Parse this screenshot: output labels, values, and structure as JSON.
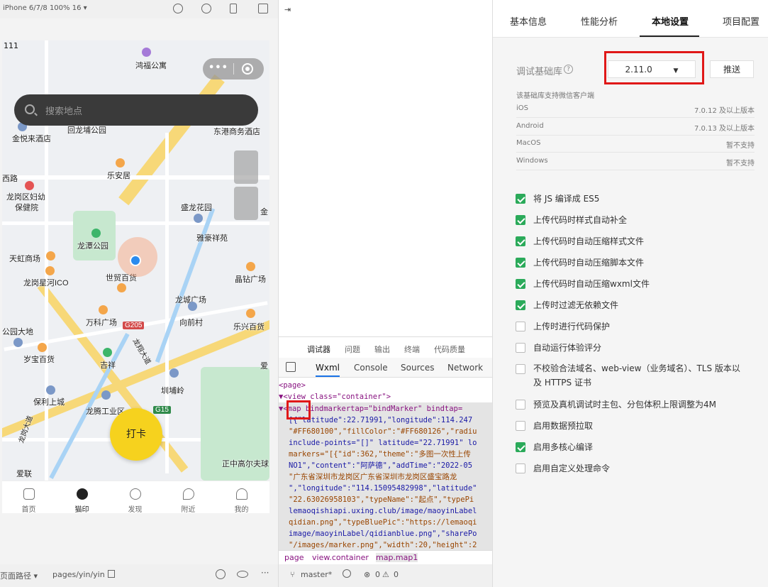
{
  "simulator": {
    "device_label": "iPhone 6/7/8 100% 16 ▾",
    "status_text": "111",
    "search_placeholder": "搜索地点",
    "daka_label": "打卡",
    "tabs": [
      {
        "label": "首页",
        "icon": "home-icon",
        "active": false
      },
      {
        "label": "猫印",
        "icon": "paw-icon",
        "active": true
      },
      {
        "label": "发现",
        "icon": "compass-icon",
        "active": false
      },
      {
        "label": "附近",
        "icon": "location-icon",
        "active": false
      },
      {
        "label": "我的",
        "icon": "user-icon",
        "active": false
      }
    ],
    "map_labels": {
      "l1": "鸿福公寓",
      "l2": "回龙埔公园",
      "l3": "金悦来酒店",
      "l4": "东港商务酒店",
      "l5": "乐安居",
      "l6": "西路",
      "l7": "龙岗区妇幼",
      "l8": "保健院",
      "l9": "盛龙花园",
      "l10": "雅豪祥苑",
      "l11": "龙潭公园",
      "l12": "天虹商场",
      "l13": "世贸百货",
      "l14": "龙岗星河ICO",
      "l15": "晶钻广场",
      "l16": "龙城广场",
      "l17": "万科广场",
      "l18": "向前村",
      "l19": "乐兴百货",
      "l20": "G205",
      "l21": "公园大地",
      "l22": "岁宝百货",
      "l23": "吉祥",
      "l24": "圳埔岭",
      "l25": "保利上城",
      "l26": "龙腾工业区",
      "l27": "G15",
      "l28": "正中高尔夫球",
      "l29": "爱联",
      "l30": "金",
      "l31": "爱",
      "l32": "龙岗大道",
      "l33": "龙翔大道"
    },
    "path_label": "页面路径 ▾",
    "path_value": "pages/yin/yin"
  },
  "devtools": {
    "tabs_top": [
      "调试器",
      "问题",
      "输出",
      "终端",
      "代码质量"
    ],
    "tabs": [
      "Wxml",
      "Console",
      "Sources",
      "Network"
    ],
    "active_tab": "Wxml",
    "code_lines": [
      "<page>",
      "▼<view class=\"container\">",
      "  ▼<map bindmarkertap=\"bindMarker\" bindtap=",
      "    [{\"latitude\":22.71991,\"longitude\":114.247",
      "    \"#FF680100\",\"fillColor\":\"#FF680126\",\"radiu",
      "    include-points=\"[]\" latitude=\"22.71991\" lo",
      "    markers=\"[{\"id\":362,\"theme\":\"多图一次性上传",
      "    NO1\",\"content\":\"阿萨德\",\"addTime\":\"2022-05",
      "    \"广东省深圳市龙岗区广东省深圳市龙岗区盛宝路龙",
      "    \",\"longitude\":\"114.15095482998\",\"latitude\"",
      "    \"22.63026958103\",\"typeName\":\"起点\",\"typePi",
      "    lemaoqishiapi.uxing.club/image/maoyinLabel",
      "    qidian.png\",\"typeBluePic\":\"https://lemaoqi",
      "    image/maoyinLabel/qidianblue.png\",\"sharePo",
      "    \"/images/marker.png\",\"width\":20,\"height\":2"
    ],
    "breadcrumbs": [
      "page",
      "view.container",
      "map.map1"
    ],
    "branch": "master*",
    "errors": "0",
    "warnings": "0"
  },
  "settings": {
    "tabs": [
      "基本信息",
      "性能分析",
      "本地设置",
      "项目配置"
    ],
    "active_tab": "本地设置",
    "lib_label": "调试基础库",
    "lib_version": "2.11.0",
    "push_label": "推送",
    "support_note": "该基础库支持微信客户端",
    "platforms": [
      {
        "name": "iOS",
        "value": "7.0.12 及以上版本"
      },
      {
        "name": "Android",
        "value": "7.0.13 及以上版本"
      },
      {
        "name": "MacOS",
        "value": "暂不支持"
      },
      {
        "name": "Windows",
        "value": "暂不支持"
      }
    ],
    "options": [
      {
        "label": "将 JS 编译成 ES5",
        "checked": true
      },
      {
        "label": "上传代码时样式自动补全",
        "checked": true
      },
      {
        "label": "上传代码时自动压缩样式文件",
        "checked": true
      },
      {
        "label": "上传代码时自动压缩脚本文件",
        "checked": true
      },
      {
        "label": "上传代码时自动压缩wxml文件",
        "checked": true
      },
      {
        "label": "上传时过滤无依赖文件",
        "checked": true
      },
      {
        "label": "上传时进行代码保护",
        "checked": false
      },
      {
        "label": "自动运行体验评分",
        "checked": false
      },
      {
        "label": "不校验合法域名、web-view（业务域名）、TLS 版本以及 HTTPS 证书",
        "checked": false
      },
      {
        "label": "预览及真机调试时主包、分包体积上限调整为4M",
        "checked": false
      },
      {
        "label": "启用数据预拉取",
        "checked": false
      },
      {
        "label": "启用多核心编译",
        "checked": true
      },
      {
        "label": "启用自定义处理命令",
        "checked": false
      }
    ]
  }
}
